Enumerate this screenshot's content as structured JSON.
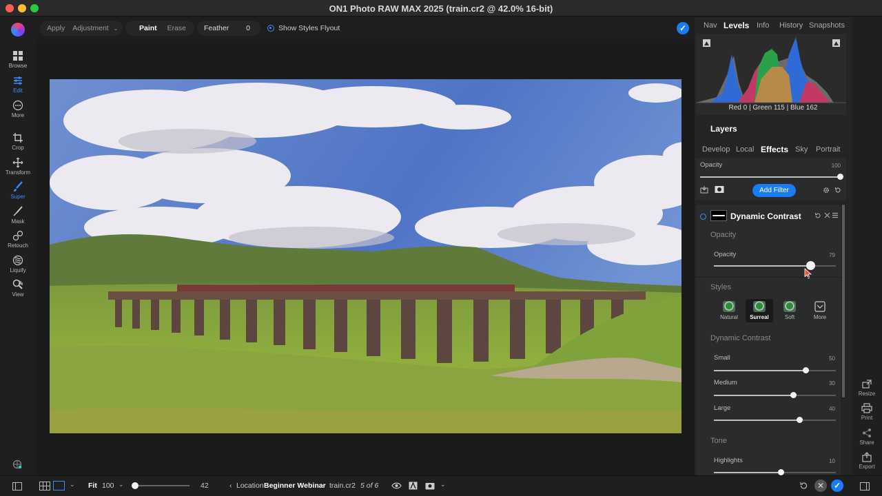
{
  "window": {
    "title": "ON1 Photo RAW MAX 2025 (train.cr2 @ 42.0% 16-bit)"
  },
  "left_tools": [
    {
      "label": "Browse",
      "icon": "grid-icon"
    },
    {
      "label": "Edit",
      "icon": "sliders-icon"
    },
    {
      "label": "More",
      "icon": "more-icon"
    },
    {
      "label": "Crop",
      "icon": "crop-icon"
    },
    {
      "label": "Transform",
      "icon": "transform-icon"
    },
    {
      "label": "Super",
      "icon": "brush-icon"
    },
    {
      "label": "Mask",
      "icon": "mask-icon"
    },
    {
      "label": "Retouch",
      "icon": "retouch-icon"
    },
    {
      "label": "Liquify",
      "icon": "liquify-icon"
    },
    {
      "label": "View",
      "icon": "hand-icon"
    }
  ],
  "toolbar": {
    "apply": "Apply",
    "adjustment": "Adjustment",
    "paint": "Paint",
    "erase": "Erase",
    "feather_label": "Feather",
    "feather_value": "0",
    "show_styles": "Show Styles Flyout"
  },
  "right_tabs": {
    "nav": "Nav",
    "levels": "Levels",
    "info": "Info",
    "history": "History",
    "snapshots": "Snapshots"
  },
  "histogram": {
    "readout": "Red  0   | Green 115 | Blue 162"
  },
  "layers": {
    "title": "Layers",
    "tabs": [
      "Develop",
      "Local",
      "Effects",
      "Sky",
      "Portrait"
    ],
    "selected_tab": "Effects",
    "opacity_label": "Opacity",
    "opacity_value": "100",
    "opacity_level": 1.0,
    "add_filter": "Add Filter"
  },
  "filter": {
    "name": "Dynamic Contrast",
    "opacity_section": "Opacity",
    "opacity_label": "Opacity",
    "opacity_value": "79",
    "opacity_level": 0.79,
    "styles_section": "Styles",
    "styles": [
      "Natural",
      "Surreal",
      "Soft",
      "More"
    ],
    "selected_style": "Surreal",
    "dc_section": "Dynamic Contrast",
    "small_label": "Small",
    "small_value": "50",
    "small_level": 0.75,
    "medium_label": "Medium",
    "medium_value": "30",
    "medium_level": 0.65,
    "large_label": "Large",
    "large_value": "40",
    "large_level": 0.7,
    "tone_section": "Tone",
    "highlights_label": "Highlights",
    "highlights_value": "10",
    "highlights_level": 0.55
  },
  "right_tools": [
    "Resize",
    "Print",
    "Share",
    "Export"
  ],
  "bottom": {
    "fit": "Fit",
    "zoom_value": "100",
    "thumb_size": "42",
    "location_prefix": "Location",
    "location": "Beginner Webinar",
    "filename": "train.cr2",
    "counter": "5 of 6"
  },
  "colors": {
    "accent": "#1a7cf2",
    "panel": "#242425",
    "background": "#1e1e1f"
  }
}
